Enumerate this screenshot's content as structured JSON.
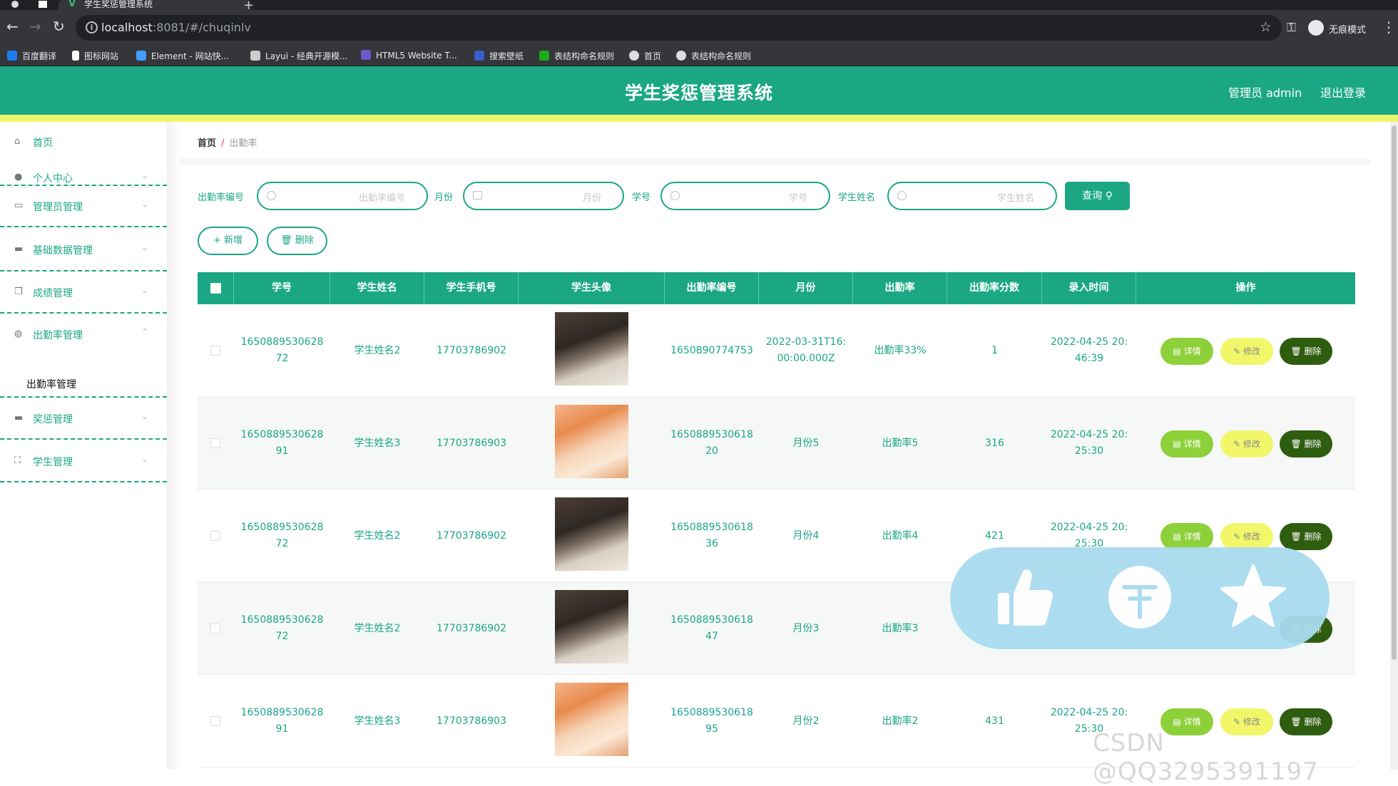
{
  "browser": {
    "tab_title": "学生奖惩管理系统",
    "url_host": "localhost",
    "url_rest": ":8081/#/chuqinlv",
    "profile_label": "无痕模式",
    "bookmarks": [
      {
        "label": "百度翻译",
        "color": "#1e7cf2"
      },
      {
        "label": "图标网站",
        "color": "#ffffff"
      },
      {
        "label": "Element - 网站快...",
        "color": "#409eff"
      },
      {
        "label": "Layui - 经典开源模...",
        "color": "#cccccc"
      },
      {
        "label": "HTML5 Website T...",
        "color": "#6a5acd"
      },
      {
        "label": "搜索壁纸",
        "color": "#3a5fcd"
      },
      {
        "label": "表结构命名规则",
        "color": "#1aad19"
      },
      {
        "label": "首页",
        "color": "#dddddd"
      },
      {
        "label": "表结构命名规则",
        "color": "#dddddd"
      }
    ]
  },
  "header": {
    "title": "学生奖惩管理系统",
    "admin_label": "管理员 admin",
    "logout_label": "退出登录"
  },
  "sidebar": {
    "items": [
      {
        "label": "首页",
        "icon": "home-icon"
      },
      {
        "label": "个人中心",
        "icon": "user-icon"
      },
      {
        "label": "管理员管理",
        "icon": "chat-icon"
      },
      {
        "label": "基础数据管理",
        "icon": "message-icon"
      },
      {
        "label": "成绩管理",
        "icon": "copy-icon"
      },
      {
        "label": "出勤率管理",
        "icon": "globe-icon"
      },
      {
        "label": "奖惩管理",
        "icon": "monitor-icon"
      },
      {
        "label": "学生管理",
        "icon": "fullscreen-icon"
      }
    ],
    "sub_item": "出勤率管理"
  },
  "breadcrumb": {
    "home": "首页",
    "sep": "/",
    "current": "出勤率"
  },
  "search": {
    "fields": [
      {
        "label": "出勤率编号",
        "placeholder": "出勤率编号"
      },
      {
        "label": "月份",
        "placeholder": "月份"
      },
      {
        "label": "学号",
        "placeholder": "学号"
      },
      {
        "label": "学生姓名",
        "placeholder": "学生姓名"
      }
    ],
    "query_label": "查询 ⚲"
  },
  "actions": {
    "add_label": "+ 新增",
    "delete_label": "🗑 删除"
  },
  "table": {
    "columns": [
      "学号",
      "学生姓名",
      "学生手机号",
      "学生头像",
      "出勤率编号",
      "月份",
      "出勤率",
      "出勤率分数",
      "录入时间",
      "操作"
    ],
    "rows": [
      {
        "id": "1650889530628 72",
        "name": "学生姓名2",
        "phone": "17703786902",
        "avatar": "boy",
        "code": "1650890774753",
        "month": "2022-03-31T16: 00:00.000Z",
        "rate": "出勤率33%",
        "score": "1",
        "time": "2022-04-25 20: 46:39"
      },
      {
        "id": "1650889530628 91",
        "name": "学生姓名3",
        "phone": "17703786903",
        "avatar": "girl",
        "code": "1650889530618 20",
        "month": "月份5",
        "rate": "出勤率5",
        "score": "316",
        "time": "2022-04-25 20: 25:30"
      },
      {
        "id": "1650889530628 72",
        "name": "学生姓名2",
        "phone": "17703786902",
        "avatar": "boy",
        "code": "1650889530618 36",
        "month": "月份4",
        "rate": "出勤率4",
        "score": "421",
        "time": "2022-04-25 20: 25:30"
      },
      {
        "id": "1650889530628 72",
        "name": "学生姓名2",
        "phone": "17703786902",
        "avatar": "boy",
        "code": "1650889530618 47",
        "month": "月份3",
        "rate": "出勤率3",
        "score": "",
        "time": ""
      },
      {
        "id": "1650889530628 91",
        "name": "学生姓名3",
        "phone": "17703786903",
        "avatar": "girl",
        "code": "1650889530618 95",
        "month": "月份2",
        "rate": "出勤率2",
        "score": "431",
        "time": "2022-04-25 20: 25:30"
      }
    ],
    "op_labels": {
      "detail": "详情",
      "edit": "修改",
      "delete": "删除"
    }
  },
  "overlay": {
    "icons": [
      "thumbs-up-icon",
      "coin-icon",
      "star-icon"
    ]
  },
  "watermark": "CSDN @QQ3295391197",
  "colors": {
    "primary": "#1ba784",
    "accent_yellow": "#ecf66b",
    "detail": "#8ed03a",
    "edit": "#f2f76a",
    "delete": "#2f5d0f"
  }
}
